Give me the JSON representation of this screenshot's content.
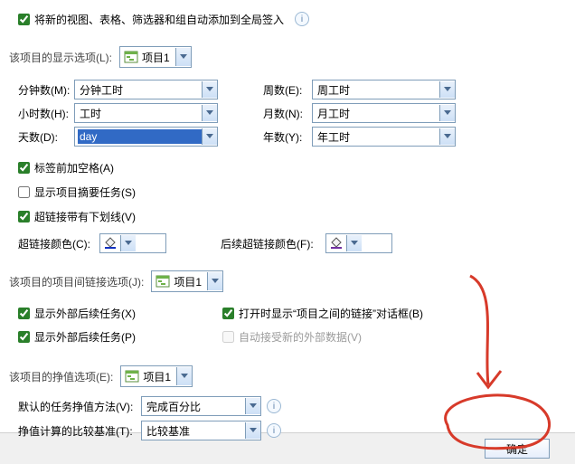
{
  "top": {
    "auto_add_label": "将新的视图、表格、筛选器和组自动添加到全局签入"
  },
  "display_section": {
    "header": "该项目的显示选项(L):",
    "project": "项目1",
    "minutes_label": "分钟数(M):",
    "minutes_value": "分钟工时",
    "hours_label": "小时数(H):",
    "hours_value": "工时",
    "days_label": "天数(D):",
    "days_value": "day",
    "weeks_label": "周数(E):",
    "weeks_value": "周工时",
    "months_label": "月数(N):",
    "months_value": "月工时",
    "years_label": "年数(Y):",
    "years_value": "年工时",
    "space_before_label": "标签前加空格(A)",
    "show_summary_tasks": "显示项目摘要任务(S)",
    "hyperlink_underline": "超链接带有下划线(V)",
    "hyperlink_color": "超链接颜色(C):",
    "followed_color": "后续超链接颜色(F):"
  },
  "crosslink_section": {
    "header": "该项目的项目间链接选项(J):",
    "project": "项目1",
    "show_ext_succ_x": "显示外部后续任务(X)",
    "show_ext_succ_p": "显示外部后续任务(P)",
    "open_dialog": "打开时显示“项目之间的链接”对话框(B)",
    "auto_accept": "自动接受新的外部数据(V)"
  },
  "ev_section": {
    "header": "该项目的挣值选项(E):",
    "project": "项目1",
    "default_method_label": "默认的任务挣值方法(V):",
    "default_method_value": "完成百分比",
    "baseline_label": "挣值计算的比较基准(T):",
    "baseline_value": "比较基准"
  },
  "footer": {
    "ok": "确定"
  },
  "icons": {
    "help": "i"
  }
}
